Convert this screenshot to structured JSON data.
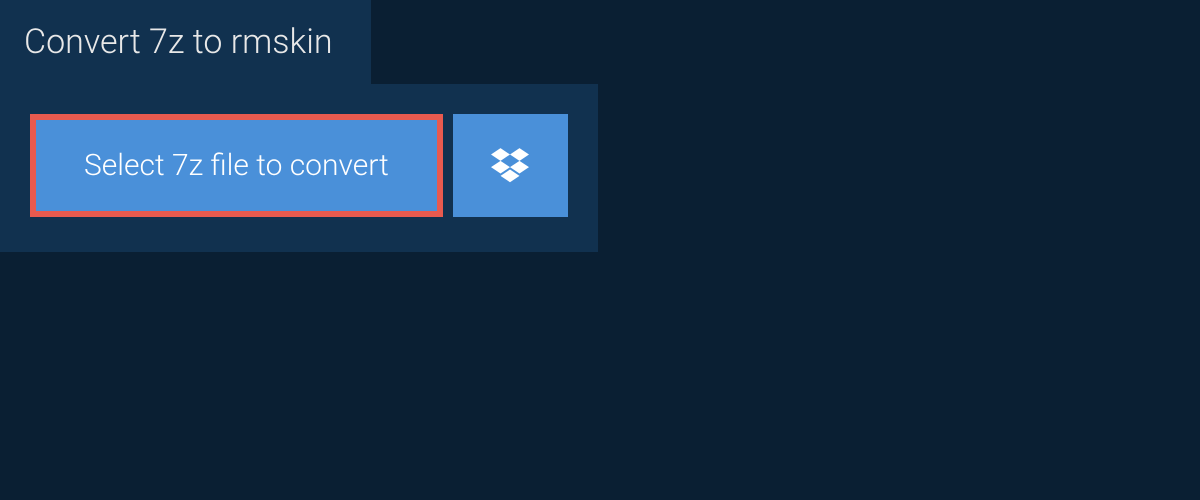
{
  "tab": {
    "title": "Convert 7z to rmskin"
  },
  "actions": {
    "select_file_label": "Select 7z file to convert"
  }
}
